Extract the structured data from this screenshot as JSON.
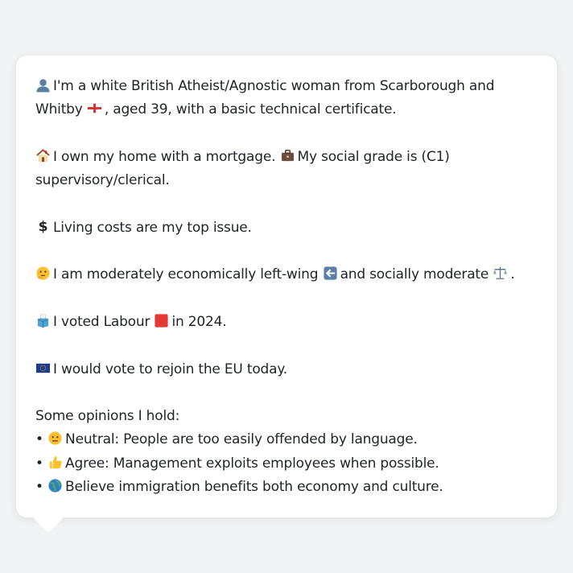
{
  "profile": {
    "identity": {
      "icon": "person-silhouette-icon",
      "text_before_flag": "I'm a white British Atheist/Agnostic woman from Scarborough and Whitby",
      "flag_icon": "england-flag-icon",
      "text_after_flag": ", aged 39, with a basic technical certificate."
    },
    "housing": {
      "icon": "house-icon",
      "text": "I own my home with a mortgage.",
      "grade_icon": "briefcase-icon",
      "grade_text": "My social grade is (C1) supervisory/clerical."
    },
    "issue": {
      "icon": "dollar-sign-icon",
      "text": "Living costs are my top issue."
    },
    "politics": {
      "icon": "thinking-face-icon",
      "text_before": "I am moderately economically left-wing",
      "left_icon": "left-arrow-icon",
      "text_middle": "and socially moderate",
      "balance_icon": "balance-scale-icon",
      "text_after": "."
    },
    "vote": {
      "icon": "ballot-box-icon",
      "text_before": "I voted Labour",
      "party_icon": "red-square-icon",
      "text_after": "in 2024."
    },
    "eu": {
      "icon": "eu-flag-icon",
      "text": "I would vote to rejoin the EU today."
    }
  },
  "opinions": {
    "heading": "Some opinions I hold:",
    "bullet": "•",
    "items": [
      {
        "icon": "neutral-face-icon",
        "text": "Neutral: People are too easily offended by language."
      },
      {
        "icon": "thumbs-up-icon",
        "text": "Agree: Management exploits employees when possible."
      },
      {
        "icon": "globe-icon",
        "text": "Believe immigration benefits both economy and culture."
      }
    ]
  },
  "colors": {
    "background": "#f1f2f4",
    "bubble": "#ffffff",
    "text": "#1f2328",
    "labour_red": "#e53935"
  }
}
